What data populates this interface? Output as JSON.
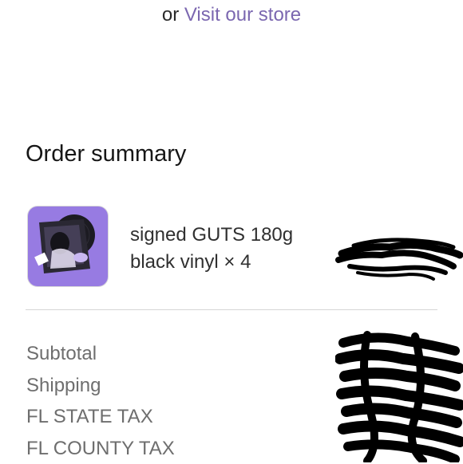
{
  "header": {
    "prefix": "or",
    "store_link": "Visit our store"
  },
  "order_summary": {
    "title": "Order summary",
    "item": {
      "name": "signed GUTS 180g",
      "variant": "black vinyl",
      "quantity_label": "× 4"
    },
    "rows": [
      {
        "label": "Subtotal"
      },
      {
        "label": "Shipping"
      },
      {
        "label": "FL STATE TAX"
      },
      {
        "label": "FL COUNTY TAX"
      }
    ]
  },
  "colors": {
    "link": "#7b67b0",
    "thumb_bg": "#8e6fdc",
    "text": "#1f1f1f",
    "muted": "#6e6e6e",
    "scribble": "#000000"
  }
}
